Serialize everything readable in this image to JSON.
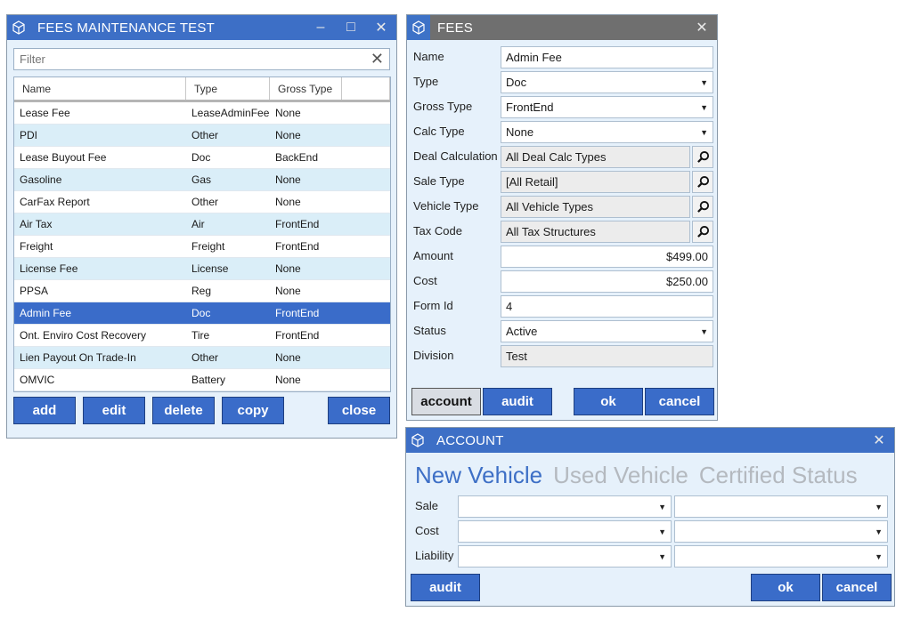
{
  "fees_maintenance": {
    "title": "FEES MAINTENANCE TEST",
    "minimize": "–",
    "maximize": "□",
    "close": "✕",
    "filter_placeholder": "Filter",
    "filter_clear": "✕",
    "columns": [
      "Name",
      "Type",
      "Gross Type"
    ],
    "rows": [
      {
        "name": "Lease Fee",
        "type": "LeaseAdminFee",
        "gross": "None"
      },
      {
        "name": "PDI",
        "type": "Other",
        "gross": "None"
      },
      {
        "name": "Lease Buyout Fee",
        "type": "Doc",
        "gross": "BackEnd"
      },
      {
        "name": "Gasoline",
        "type": "Gas",
        "gross": "None"
      },
      {
        "name": "CarFax Report",
        "type": "Other",
        "gross": "None"
      },
      {
        "name": "Air Tax",
        "type": "Air",
        "gross": "FrontEnd"
      },
      {
        "name": "Freight",
        "type": "Freight",
        "gross": "FrontEnd"
      },
      {
        "name": "License Fee",
        "type": "License",
        "gross": "None"
      },
      {
        "name": "PPSA",
        "type": "Reg",
        "gross": "None"
      },
      {
        "name": "Admin Fee",
        "type": "Doc",
        "gross": "FrontEnd"
      },
      {
        "name": "Ont. Enviro Cost Recovery",
        "type": "Tire",
        "gross": "FrontEnd"
      },
      {
        "name": "Lien Payout On Trade-In",
        "type": "Other",
        "gross": "None"
      },
      {
        "name": "OMVIC",
        "type": "Battery",
        "gross": "None"
      }
    ],
    "selected_row": "Admin Fee",
    "buttons": {
      "add": "add",
      "edit": "edit",
      "delete": "delete",
      "copy": "copy",
      "close": "close"
    }
  },
  "fees": {
    "title": "FEES",
    "close": "✕",
    "labels": {
      "name": "Name",
      "type": "Type",
      "gross_type": "Gross Type",
      "calc_type": "Calc Type",
      "deal_calculation": "Deal Calculation",
      "sale_type": "Sale Type",
      "vehicle_type": "Vehicle Type",
      "tax_code": "Tax Code",
      "amount": "Amount",
      "cost": "Cost",
      "form_id": "Form Id",
      "status": "Status",
      "division": "Division"
    },
    "values": {
      "name": "Admin Fee",
      "type": "Doc",
      "gross_type": "FrontEnd",
      "calc_type": "None",
      "deal_calculation": "All Deal Calc Types",
      "sale_type": "[All Retail]",
      "vehicle_type": "All Vehicle Types",
      "tax_code": "All Tax Structures",
      "amount": "$499.00",
      "cost": "$250.00",
      "form_id": "4",
      "status": "Active",
      "division": "Test"
    },
    "dropdown_arrow": "▼",
    "buttons": {
      "account": "account",
      "audit": "audit",
      "ok": "ok",
      "cancel": "cancel"
    }
  },
  "account": {
    "title": "ACCOUNT",
    "close": "✕",
    "tabs": [
      "New Vehicle",
      "Used Vehicle",
      "Certified Status"
    ],
    "active_tab": "New Vehicle",
    "rows": [
      "Sale",
      "Cost",
      "Liability"
    ],
    "dropdown_arrow": "▼",
    "buttons": {
      "audit": "audit",
      "ok": "ok",
      "cancel": "cancel"
    }
  },
  "colors": {
    "accent": "#3a6cc9",
    "title_gray": "#6f6f6f",
    "window_bg": "#e6f1fb",
    "row_alt": "#daeef8"
  }
}
